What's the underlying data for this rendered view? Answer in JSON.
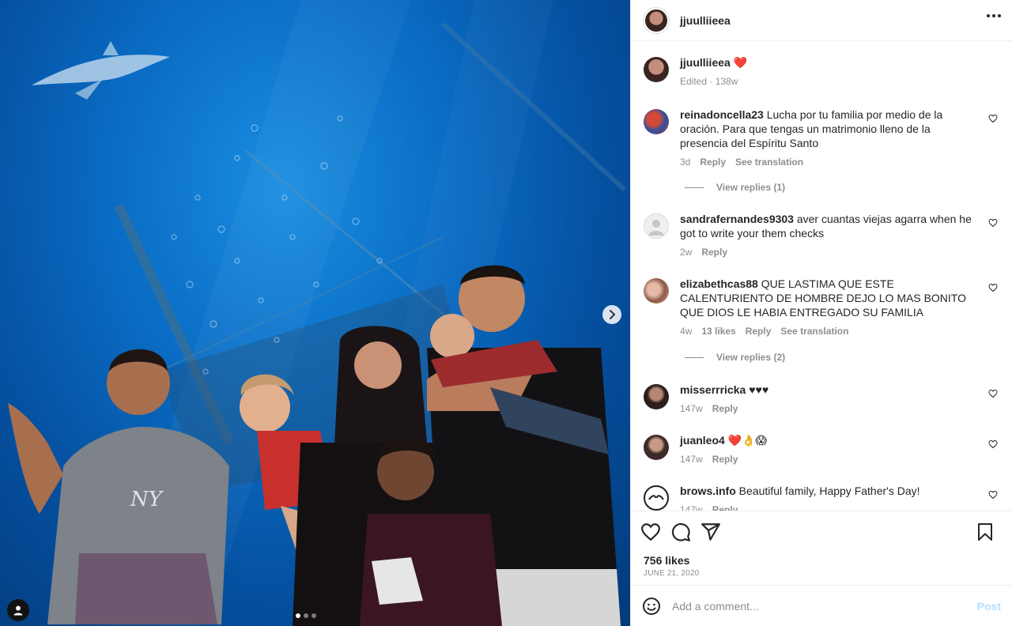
{
  "media": {
    "dots": 3,
    "active_dot": 0
  },
  "header": {
    "username": "jjuulliieea"
  },
  "caption": {
    "username": "jjuulliieea",
    "emoji": "❤️",
    "meta": "Edited · 138w"
  },
  "comments": [
    {
      "username": "reinadoncella23",
      "text": "Lucha por tu familia por medio de la oración. Para que tengas un matrimonio lleno de la presencia del Espíritu Santo",
      "time": "3d",
      "likes": "",
      "reply": "Reply",
      "translate": "See translation",
      "view_replies": "View replies (1)",
      "avatar_color": "#c0392b"
    },
    {
      "username": "sandrafernandes9303",
      "text": "aver cuantas viejas agarra when he got to write your them checks",
      "time": "2w",
      "likes": "",
      "reply": "Reply",
      "translate": "",
      "view_replies": "",
      "avatar_color": "#dbdbdb"
    },
    {
      "username": "elizabethcas88",
      "text": "QUE LASTIMA QUE ESTE CALENTURIENTO DE HOMBRE DEJO LO MAS BONITO QUE DIOS LE HABIA ENTREGADO SU FAMILIA",
      "time": "4w",
      "likes": "13 likes",
      "reply": "Reply",
      "translate": "See translation",
      "view_replies": "View replies (2)",
      "avatar_color": "#b07a6a"
    },
    {
      "username": "misserrricka",
      "text": "♥♥♥",
      "time": "147w",
      "likes": "",
      "reply": "Reply",
      "translate": "",
      "view_replies": "",
      "avatar_color": "#4a3b36"
    },
    {
      "username": "juanleo4",
      "text": "❤️👌😱",
      "time": "147w",
      "likes": "",
      "reply": "Reply",
      "translate": "",
      "view_replies": "",
      "avatar_color": "#5b4a42"
    },
    {
      "username": "brows.info",
      "text": "Beautiful family, Happy Father's Day!",
      "time": "147w",
      "likes": "",
      "reply": "Reply",
      "translate": "",
      "view_replies": "",
      "avatar_color": "#222222"
    }
  ],
  "stats": {
    "likes": "756 likes",
    "date": "JUNE 21, 2020"
  },
  "add_comment": {
    "placeholder": "Add a comment...",
    "post_label": "Post"
  },
  "colors": {
    "heart_red": "#ed4956",
    "post_disabled": "#b2dffc",
    "muted": "#8e8e8e"
  },
  "icons": [
    "heart-icon",
    "comment-icon",
    "share-icon",
    "bookmark-icon",
    "more-icon",
    "emoji-icon",
    "chevron-right-icon",
    "user-tag-icon"
  ]
}
